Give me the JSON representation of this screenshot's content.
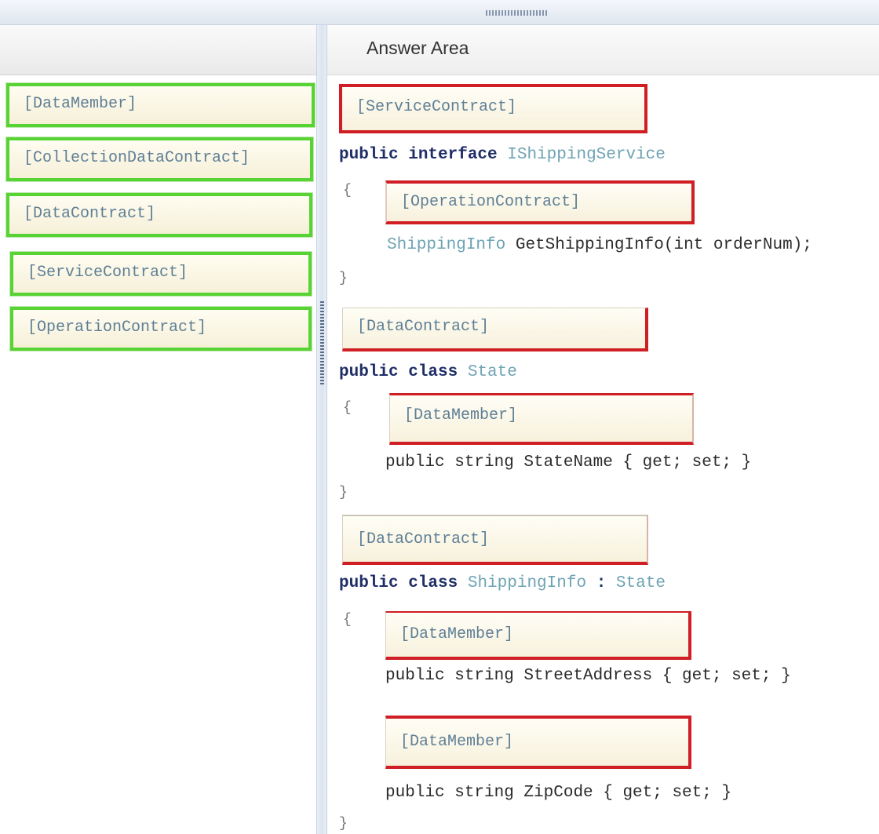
{
  "answer_area": {
    "title": "Answer Area"
  },
  "source_items": [
    {
      "label": "[DataMember]"
    },
    {
      "label": "[CollectionDataContract]"
    },
    {
      "label": "[DataContract]"
    },
    {
      "label": "[ServiceContract]"
    },
    {
      "label": "[OperationContract]"
    }
  ],
  "targets": [
    {
      "label": "[ServiceContract]"
    },
    {
      "label": "[OperationContract]"
    },
    {
      "label": "[DataContract]"
    },
    {
      "label": "[DataMember]"
    },
    {
      "label": "[DataContract]"
    },
    {
      "label": "[DataMember]"
    },
    {
      "label": "[DataMember]"
    }
  ],
  "code": {
    "l1_kw": "public interface",
    "l1_type": "IShippingService",
    "open1": "{",
    "l2_type": "ShippingInfo",
    "l2_rest": "GetShippingInfo(int orderNum);",
    "close1": "}",
    "l3_kw": "public class",
    "l3_type": "State",
    "open2": "{",
    "l4": "public string StateName { get; set; }",
    "close2": "}",
    "l5_kw": "public class",
    "l5_type": "ShippingInfo",
    "l5_colon": ":",
    "l5_base": "State",
    "open3": "{",
    "l6": "public string StreetAddress { get; set; }",
    "l7": "public string ZipCode { get; set; }",
    "close3": "}"
  },
  "colors": {
    "source_border": "#58d334",
    "target_border": "#cf1f24",
    "keyword": "#1f2e66",
    "type_name": "#6ea3b3"
  }
}
